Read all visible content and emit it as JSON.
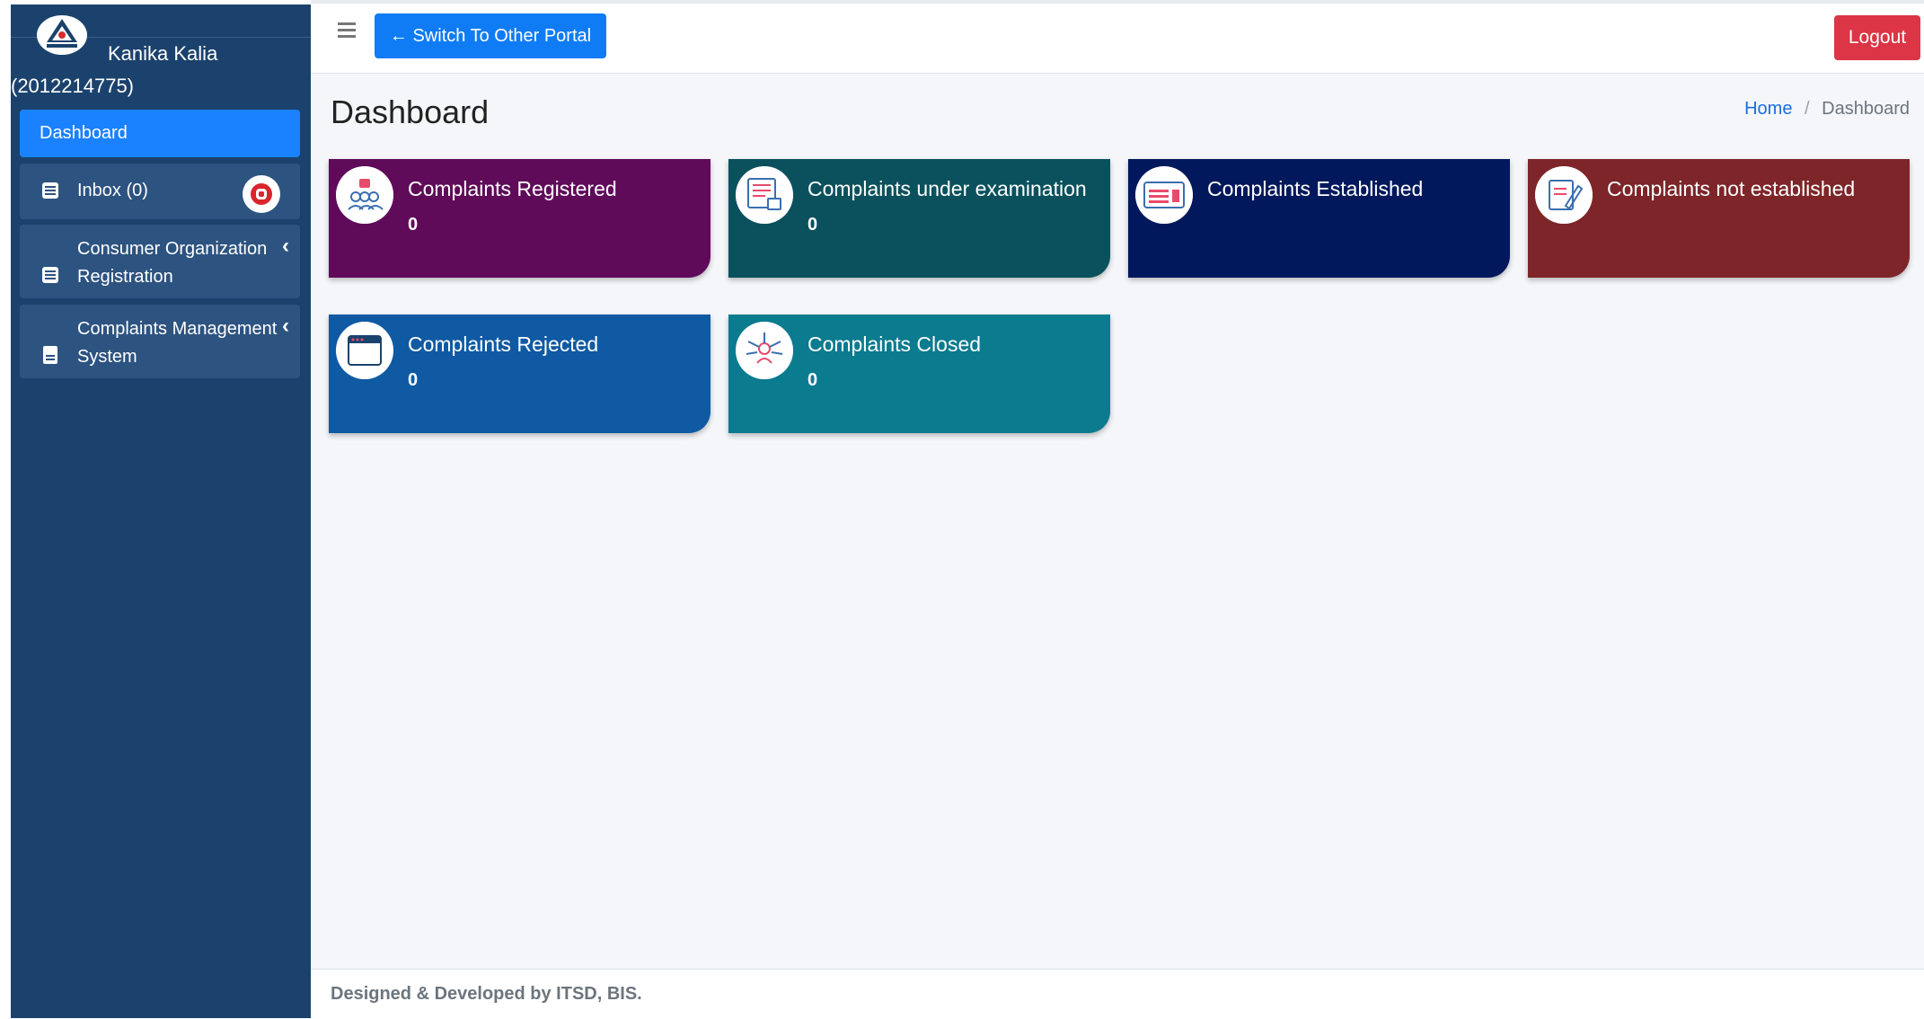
{
  "user": {
    "name": "Kanika Kalia",
    "id": "(2012214775)"
  },
  "sidebar": {
    "items": [
      {
        "label": "Dashboard"
      },
      {
        "label": "Inbox (0)"
      },
      {
        "label_line1": "Consumer Organization",
        "label_line2": "Registration"
      },
      {
        "label_line1": "Complaints Management",
        "label_line2": "System"
      }
    ]
  },
  "header": {
    "switch_label": "Switch To Other Portal",
    "logout_label": "Logout"
  },
  "page": {
    "title": "Dashboard",
    "breadcrumb": {
      "home": "Home",
      "separator": "/",
      "current": "Dashboard"
    }
  },
  "cards": [
    {
      "title": "Complaints Registered",
      "value": "0",
      "color": "#600a5a"
    },
    {
      "title": "Complaints under examination",
      "value": "0",
      "color": "#0a515d"
    },
    {
      "title": "Complaints Established",
      "value": "0",
      "color": "#02185c"
    },
    {
      "title": "Complaints not established",
      "value": "0",
      "color": "#7d2528"
    },
    {
      "title": "Complaints Rejected",
      "value": "0",
      "color": "#0f5aa3"
    },
    {
      "title": "Complaints Closed",
      "value": "0",
      "color": "#0b7b90"
    }
  ],
  "footer": {
    "text": "Designed & Developed by ITSD, BIS."
  }
}
